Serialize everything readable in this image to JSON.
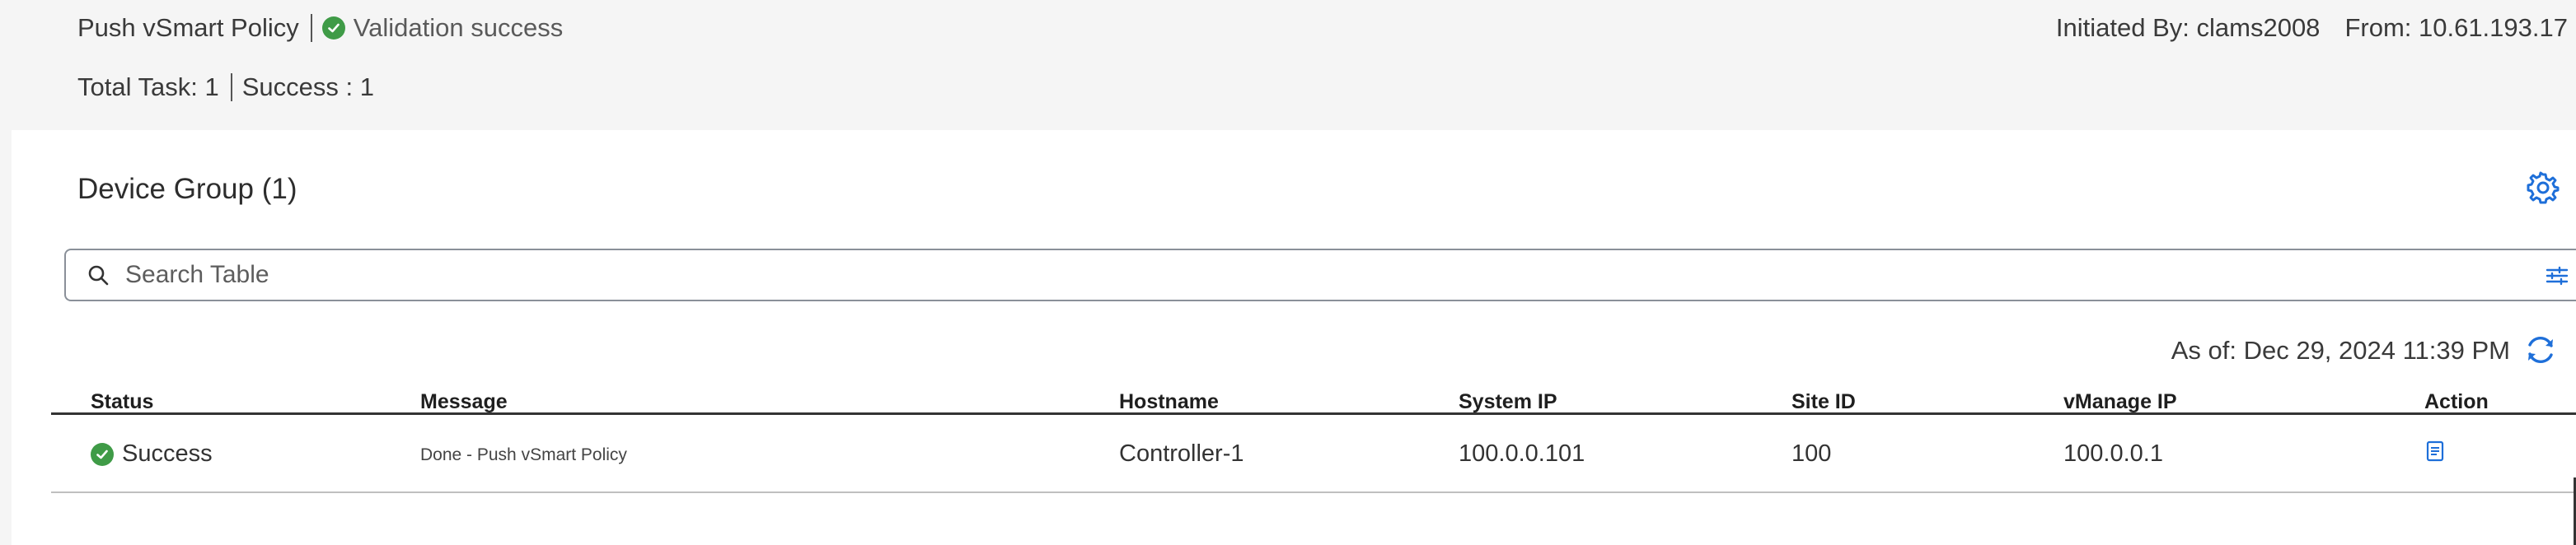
{
  "header": {
    "task_title": "Push vSmart Policy",
    "validation_text": "Validation success",
    "initiated_by": "Initiated By: clams2008",
    "from": "From: 10.61.193.17",
    "total_task": "Total Task: 1",
    "success_count": "Success : 1"
  },
  "device_group": {
    "title": "Device Group (1)"
  },
  "search": {
    "placeholder": "Search Table"
  },
  "as_of": "As of: Dec 29, 2024 11:39 PM",
  "table": {
    "columns": [
      "Status",
      "Message",
      "Hostname",
      "System IP",
      "Site ID",
      "vManage IP",
      "Action"
    ],
    "rows": [
      {
        "status": "Success",
        "message": "Done - Push vSmart Policy",
        "hostname": "Controller-1",
        "system_ip": "100.0.0.101",
        "site_id": "100",
        "vmanage_ip": "100.0.0.1"
      }
    ]
  },
  "colors": {
    "success_green": "#3f9b47",
    "accent_blue": "#1e6fd9"
  },
  "icons": [
    "check-circle-icon",
    "gear-icon",
    "search-icon",
    "filter-icon",
    "refresh-icon",
    "document-icon"
  ]
}
